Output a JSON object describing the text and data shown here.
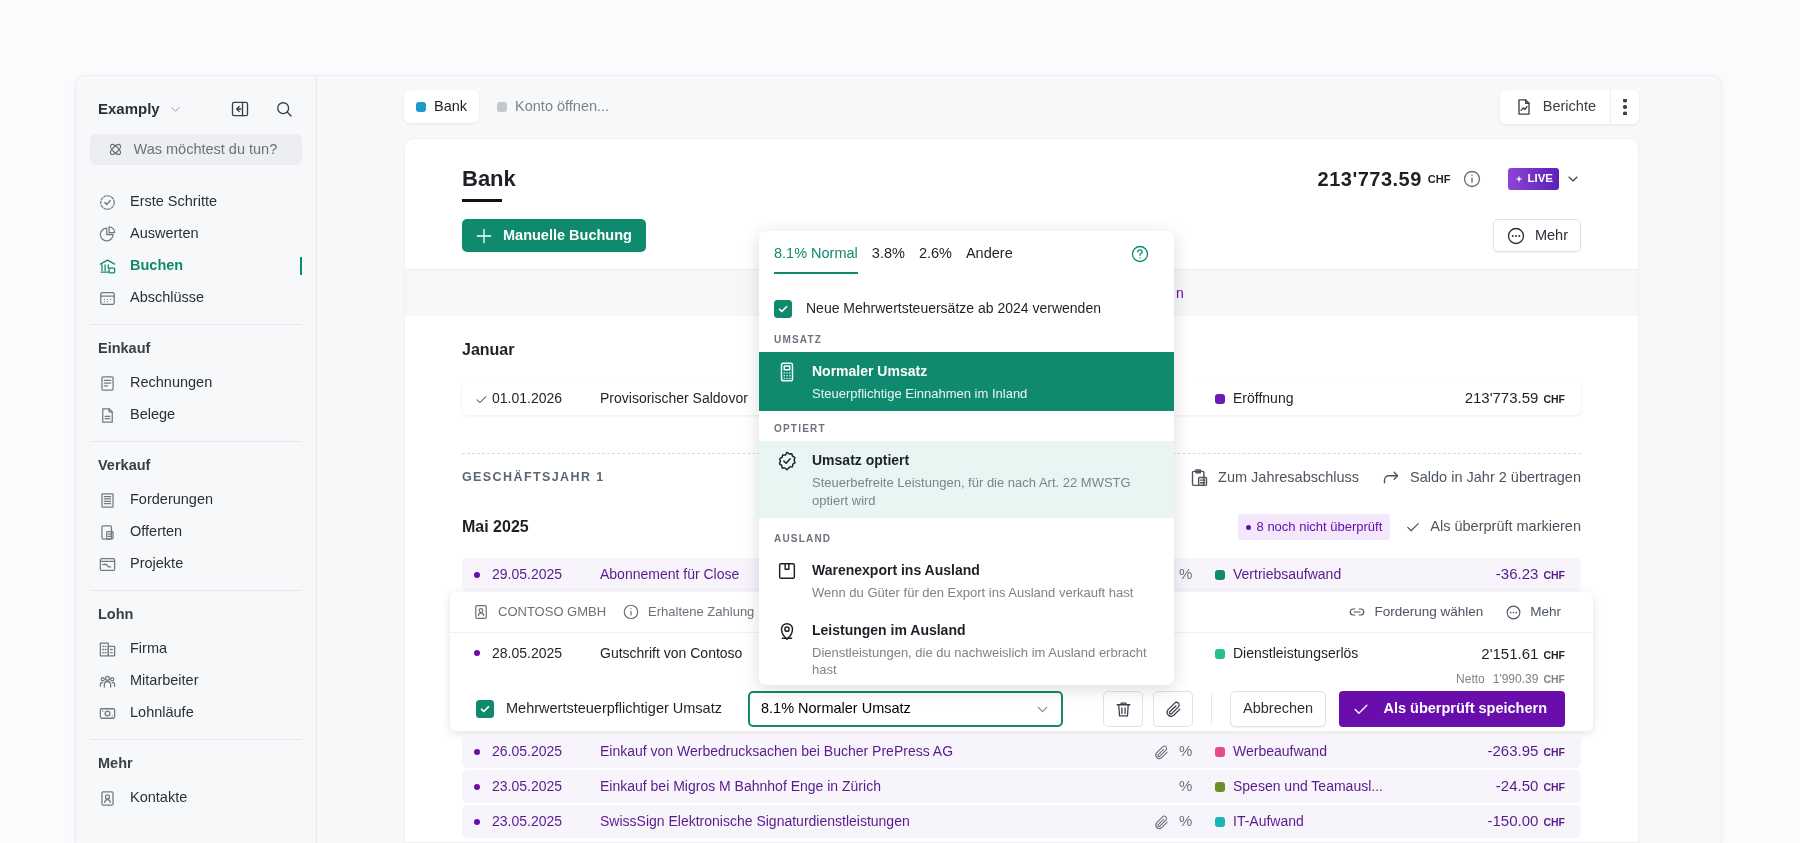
{
  "sidebar": {
    "brand": "Examply",
    "command": {
      "placeholder": "Was möchtest du tun?"
    },
    "groups": [
      {
        "items": [
          {
            "label": "Erste Schritte",
            "selected": false
          },
          {
            "label": "Auswerten",
            "selected": false
          },
          {
            "label": "Buchen",
            "selected": true
          },
          {
            "label": "Abschlüsse",
            "selected": false
          }
        ]
      },
      {
        "title": "Einkauf",
        "items": [
          {
            "label": "Rechnungen",
            "selected": false
          },
          {
            "label": "Belege",
            "selected": false
          }
        ]
      },
      {
        "title": "Verkauf",
        "items": [
          {
            "label": "Forderungen",
            "selected": false
          },
          {
            "label": "Offerten",
            "selected": false
          },
          {
            "label": "Projekte",
            "selected": false
          }
        ]
      },
      {
        "title": "Lohn",
        "items": [
          {
            "label": "Firma",
            "selected": false
          },
          {
            "label": "Mitarbeiter",
            "selected": false
          },
          {
            "label": "Lohnläufe",
            "selected": false
          }
        ]
      },
      {
        "title": "Mehr",
        "items": [
          {
            "label": "Kontakte",
            "selected": false
          }
        ]
      }
    ]
  },
  "tabs": [
    {
      "label": "Bank",
      "selected": true,
      "color": "#1a9bc7"
    },
    {
      "label": "Konto öffnen...",
      "selected": false,
      "color": "#c3c8cd"
    }
  ],
  "toolbar": {
    "reports": "Berichte"
  },
  "account": {
    "title": "Bank",
    "balance": "213'773.59",
    "currency": "CHF",
    "live": "LIVE",
    "new_button": "Manuelle Buchung",
    "more_button": "Mehr"
  },
  "notice": {
    "text": "n"
  },
  "january": {
    "title": "Januar",
    "rows": [
      {
        "kind": "row",
        "reviewed": true,
        "date": "01.01.2026",
        "text": "Provisorischer Saldovor",
        "attachment": false,
        "category": "Eröffnung",
        "color": "#6a1bb5",
        "amount": "213'773.59",
        "currency": "CHF"
      }
    ]
  },
  "fiscal_year": {
    "label": "GESCHÄFTSJAHR 1",
    "actions": [
      "Zum Jahresabschluss",
      "Saldo in Jahr 2 übertragen"
    ]
  },
  "month": {
    "title": "Mai 2025",
    "badge": "8 noch nicht überprüft",
    "action": "Als überprüft markieren",
    "rows": [
      {
        "kind": "row",
        "reviewed": false,
        "date": "29.05.2025",
        "text": "Abonnement für Close",
        "attachment": false,
        "vat": "%",
        "category": "Vertriebsaufwand",
        "color": "#0f8a6e",
        "amount": "-36.23",
        "currency": "CHF"
      },
      {
        "kind": "editor",
        "contact": "CONTOSO GMBH",
        "type": "Erhaltene Zahlung",
        "link": "Forderung wählen",
        "more": "Mehr",
        "date": "28.05.2025",
        "text": "Gutschrift von Contoso",
        "category": "Dienstleistungserlös",
        "color": "#22c08a",
        "amount": "2'151.61",
        "currency": "CHF",
        "net_label": "Netto",
        "net_amount": "1'990.39",
        "net_currency": "CHF",
        "vat_checkbox": {
          "label": "Mehrwertsteuerpflichtiger Umsatz",
          "checked": true
        },
        "vat_select": {
          "value": "8.1% Normaler Umsatz"
        },
        "cancel": "Abbrechen",
        "save": "Als überprüft speichern"
      },
      {
        "kind": "row",
        "reviewed": false,
        "date": "26.05.2025",
        "text": "Einkauf von Werbedrucksachen bei Bucher PrePress AG",
        "attachment": true,
        "vat": "%",
        "category": "Werbeaufwand",
        "color": "#e8498f",
        "amount": "-263.95",
        "currency": "CHF"
      },
      {
        "kind": "row",
        "reviewed": false,
        "date": "23.05.2025",
        "text": "Einkauf bei Migros M Bahnhof Enge in Zürich",
        "attachment": false,
        "vat": "%",
        "category": "Spesen und Teamausl...",
        "color": "#6b8e2a",
        "amount": "-24.50",
        "currency": "CHF"
      },
      {
        "kind": "row",
        "reviewed": false,
        "date": "23.05.2025",
        "text": "SwissSign Elektronische Signaturdienstleistungen",
        "attachment": true,
        "vat": "%",
        "category": "IT-Aufwand",
        "color": "#17b5b5",
        "amount": "-150.00",
        "currency": "CHF"
      }
    ]
  },
  "vat_menu": {
    "tabs": [
      {
        "label": "8.1% Normal",
        "selected": true
      },
      {
        "label": "3.8%",
        "selected": false
      },
      {
        "label": "2.6%",
        "selected": false
      },
      {
        "label": "Andere",
        "selected": false
      }
    ],
    "option": {
      "label": "Neue Mehrwertsteuersätze ab 2024 verwenden",
      "checked": true
    },
    "groups": [
      {
        "title": "UMSATZ",
        "items": [
          {
            "title": "Normaler Umsatz",
            "description": "Steuerpflichtige Einnahmen im Inland",
            "selected": true,
            "hovered": false
          }
        ]
      },
      {
        "title": "OPTIERT",
        "items": [
          {
            "title": "Umsatz optiert",
            "description": "Steuerbefreite Leistungen, für die nach Art. 22 MWSTG optiert wird",
            "selected": false,
            "hovered": true
          }
        ]
      },
      {
        "title": "AUSLAND",
        "items": [
          {
            "title": "Warenexport ins Ausland",
            "description": "Wenn du Güter für den Export ins Ausland verkauft hast",
            "selected": false,
            "hovered": false
          },
          {
            "title": "Leistungen im Ausland",
            "description": "Dienstleistungen, die du nachweislich im Ausland erbracht hast",
            "selected": false,
            "hovered": false
          }
        ]
      }
    ]
  }
}
